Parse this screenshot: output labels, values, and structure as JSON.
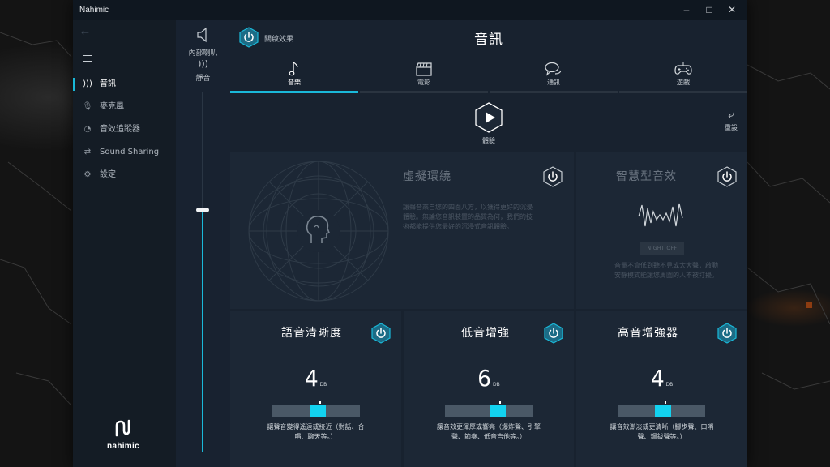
{
  "window": {
    "title": "Nahimic"
  },
  "nav": {
    "items": [
      {
        "label": "音訊",
        "icon": "audio-wave-icon",
        "active": true
      },
      {
        "label": "麥克風",
        "icon": "microphone-icon",
        "active": false
      },
      {
        "label": "音效追蹤器",
        "icon": "sound-tracker-icon",
        "active": false
      },
      {
        "label": "Sound Sharing",
        "icon": "sound-sharing-icon",
        "active": false
      },
      {
        "label": "設定",
        "icon": "gear-icon",
        "active": false
      }
    ],
    "brand": "nahimic"
  },
  "device": {
    "name": "內部喇叭",
    "mute_label": "靜音",
    "volume_percent": 67
  },
  "header": {
    "effect_label": "關啟效果",
    "title": "音訊"
  },
  "tabs": [
    {
      "label": "音樂",
      "icon": "music-note-icon",
      "active": true
    },
    {
      "label": "電影",
      "icon": "clapperboard-icon",
      "active": false
    },
    {
      "label": "通訊",
      "icon": "chat-bubbles-icon",
      "active": false
    },
    {
      "label": "遊戲",
      "icon": "gamepad-icon",
      "active": false
    }
  ],
  "demo": {
    "label": "體驗"
  },
  "reset": {
    "label": "重設"
  },
  "surround": {
    "title": "虛擬環繞",
    "desc_lines": [
      "讓聲音來自您的四面八方，以獲得更好的沉浸",
      "體驗。無論您音訊裝置的品質為何，我們的技",
      "術都能提供您最好的沉浸式音訊體驗。"
    ]
  },
  "smart": {
    "title": "智慧型音效",
    "button": "NIGHT OFF",
    "desc_lines": [
      "音量不會低到聽不見或太大聲，啟動",
      "安靜模式能讓您周圍的人不被打擾。"
    ]
  },
  "eq": [
    {
      "title": "語音清晰度",
      "value": "4",
      "unit": "DB",
      "level": 4,
      "max": 12,
      "desc_lines": [
        "讓聲音變得遙遠或接近（對話、合",
        "唱、聊天等。）"
      ]
    },
    {
      "title": "低音增強",
      "value": "6",
      "unit": "DB",
      "level": 6,
      "max": 12,
      "desc_lines": [
        "讓音效更渾厚或響亮（爆炸聲、引擎",
        "聲、節奏、低音吉他等。）"
      ]
    },
    {
      "title": "高音增強器",
      "value": "4",
      "unit": "DB",
      "level": 4,
      "max": 12,
      "desc_lines": [
        "讓音效漸淡或更清晰（腳步聲、口哨",
        "聲、鋼鈸聲等。）"
      ]
    }
  ],
  "colors": {
    "accent": "#1ab9d9",
    "eq_fill": "#12d2f0",
    "window_bg": "#141d27",
    "panel_bg": "#1c2735"
  }
}
